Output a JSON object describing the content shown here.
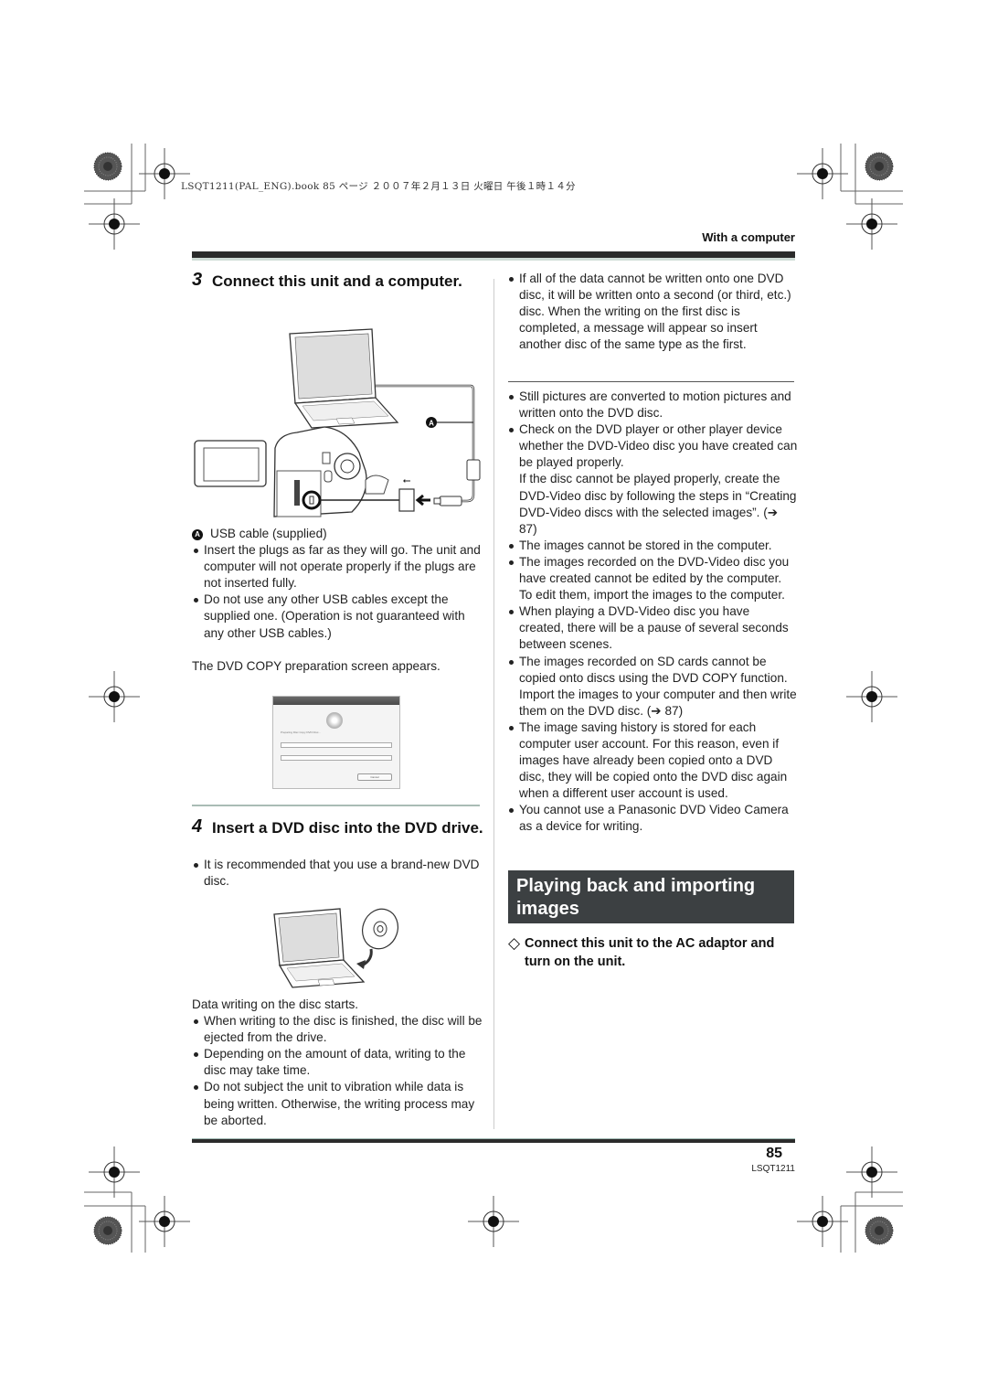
{
  "header": {
    "print_line": "LSQT1211(PAL_ENG).book  85 ページ  ２００７年２月１３日  火曜日  午後１時１４分",
    "section_label": "With a computer"
  },
  "left_column": {
    "step3": {
      "number": "3",
      "title": "Connect this unit and a computer."
    },
    "figure1": {
      "callout": "A",
      "usb_symbol": "⭠"
    },
    "callout_item": {
      "marker": "A",
      "text": "USB cable (supplied)"
    },
    "step3_notes": [
      "Insert the plugs as far as they will go. The unit and computer will not operate properly if the plugs are not inserted fully.",
      "Do not use any other USB cables except the supplied one. (Operation is not guaranteed with any other USB cables.)"
    ],
    "step3_result": "The DVD COPY preparation screen appears.",
    "screenshot_dialog": {
      "status": "Preparing Disc Copy DVD Disc...",
      "cancel_label": "Cancel"
    },
    "step4": {
      "number": "4",
      "title": "Insert a DVD disc into the DVD drive."
    },
    "step4_notes": [
      "It is recommended that you use a brand-new DVD disc."
    ],
    "step4_result": "Data writing on the disc starts.",
    "writing_notes": [
      "When writing to the disc is finished, the disc will be ejected from the drive.",
      "Depending on the amount of data, writing to the disc may take time.",
      "Do not subject the unit to vibration while data is being written. Otherwise, the writing process may be aborted."
    ]
  },
  "right_column": {
    "note_top": "If all of the data cannot be written onto one DVD disc, it will be written onto a second (or third, etc.) disc. When the writing on the first disc is completed, a message will appear so insert another disc of the same type as the first.",
    "notes": [
      {
        "text": "Still pictures are converted to motion pictures and written onto the DVD disc."
      },
      {
        "text": "Check on the DVD player or other player device whether the DVD-Video disc you have created can be played properly.",
        "continuation": "If the disc cannot be played properly, create the DVD-Video disc by following the steps in “Creating DVD-Video discs with the selected images”. (➔ 87)"
      },
      {
        "text": "The images cannot be stored in the computer."
      },
      {
        "text": "The images recorded on the DVD-Video disc you have created cannot be edited by the computer. To edit them, import the images to the computer."
      },
      {
        "text": "When playing a DVD-Video disc you have created, there will be a pause of several seconds between scenes."
      },
      {
        "text": "The images recorded on SD cards cannot be copied onto discs using the DVD COPY function. Import the images to your computer and then write them on the DVD disc. (➔ 87)"
      },
      {
        "text": "The image saving history is stored for each computer user account. For this reason, even if images have already been copied onto a DVD disc, they will be copied onto the DVD disc again when a different user account is used."
      },
      {
        "text": "You cannot use a Panasonic DVD Video Camera as a device for writing."
      }
    ],
    "banner_title": "Playing back and importing images",
    "diamond_symbol": "◇",
    "diamond_step": "Connect this unit to the AC adaptor and turn on the unit."
  },
  "footer": {
    "page_number": "85",
    "code": "LSQT1211"
  }
}
